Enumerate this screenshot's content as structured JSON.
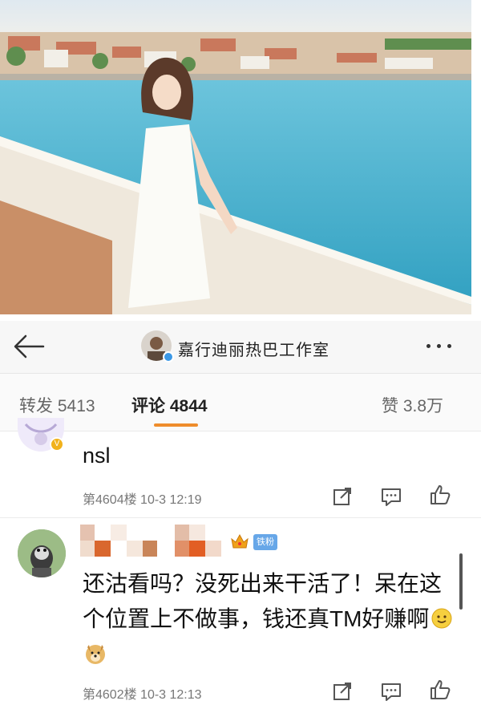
{
  "header": {
    "title": "嘉行迪丽热巴工作室",
    "back_icon": "back-arrow-icon",
    "more_icon": "more-dots-icon"
  },
  "tabs": {
    "repost_label": "转发",
    "repost_count": "5413",
    "comments_label": "评论",
    "comments_count": "4844",
    "likes_label": "赞",
    "likes_count": "3.8万",
    "active": "comments",
    "accent_color": "#ef8d2c"
  },
  "comments": [
    {
      "text": "nsl",
      "floor_time": "第4604楼  10-3 12:19",
      "badge": "gold-v-badge",
      "actions": [
        "share-icon",
        "comment-icon",
        "like-icon"
      ]
    },
    {
      "username_blurred": true,
      "fan_badge": "铁粉",
      "text": "还沽看吗？没死出来干活了！呆在这个位置上不做事，钱还真TM好赚啊",
      "emojis": [
        "smile-emoji-icon",
        "doge-emoji-icon"
      ],
      "floor_time": "第4602楼  10-3 12:13",
      "actions": [
        "share-icon",
        "comment-icon",
        "like-icon"
      ]
    }
  ]
}
